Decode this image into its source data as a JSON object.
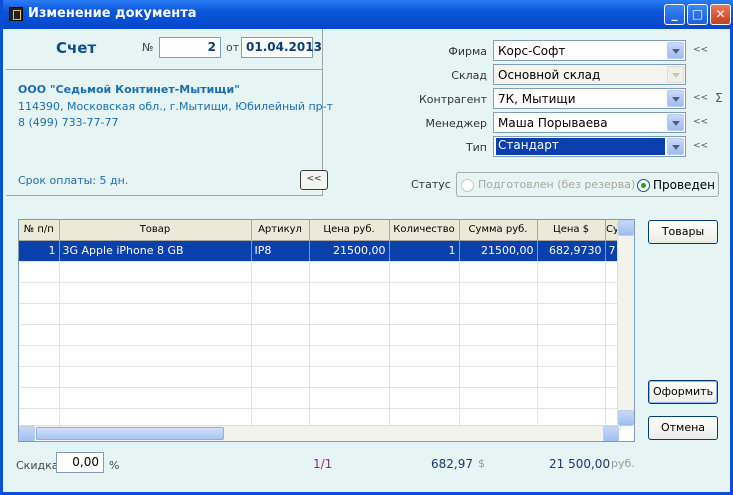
{
  "window": {
    "title": "Изменение документа",
    "min": "_",
    "max": "□",
    "close": "✕"
  },
  "header": {
    "doc_kind": "Счет",
    "number_label": "№",
    "number": "2",
    "date_label": "от",
    "date": "01.04.2013"
  },
  "organization": {
    "name": "ООО \"Седьмой Континет-Мытищи\"",
    "address": "114390, Московская обл., г.Мытищи, Юбилейный пр-т",
    "phone": "8 (499) 733-77-77",
    "payment_term": "Срок оплаты: 5 дн.",
    "back_button": "<<"
  },
  "form": {
    "firm": {
      "label": "Фирма",
      "value": "Корс-Софт"
    },
    "warehouse": {
      "label": "Склад",
      "value": "Основной склад"
    },
    "counterparty": {
      "label": "Контрагент",
      "value": "7К, Мытищи"
    },
    "manager": {
      "label": "Менеджер",
      "value": "Маша Порываева"
    },
    "type": {
      "label": "Тип",
      "value": "Стандарт"
    },
    "chevron": "<<",
    "sigma": "Σ"
  },
  "status": {
    "label": "Статус",
    "option1": "Подготовлен (без резерва)",
    "option2": "Проведен",
    "selected": "Проведен"
  },
  "table": {
    "columns": [
      "№ п/п",
      "Товар",
      "Артикул",
      "Цена руб.",
      "Количество",
      "Сумма руб.",
      "Цена $",
      "Су"
    ],
    "rows": [
      [
        "1",
        "3G Apple iPhone  8 GB",
        "IP8",
        "21500,00",
        "1",
        "21500,00",
        "682,9730",
        "7"
      ]
    ]
  },
  "buttons": {
    "goods": "Товары",
    "checkout": "Оформить",
    "cancel": "Отмена"
  },
  "footer": {
    "discount_label": "Скидка",
    "discount_value": "0,00",
    "discount_unit": "%",
    "page": "1/1",
    "total_usd": "682,97",
    "usd_symbol": "$",
    "total_rub": "21 500,00",
    "rub_unit": "руб."
  }
}
